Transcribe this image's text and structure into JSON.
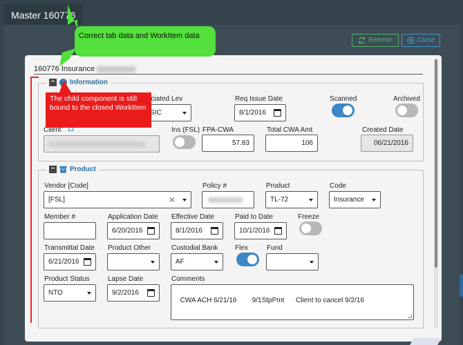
{
  "window": {
    "title": "Master 160776"
  },
  "toolbar": {
    "refresh_label": "Refresh",
    "close_label": "Close"
  },
  "record": {
    "title": "160776 Insurance"
  },
  "annotations": {
    "green": "Correct tab data and WorkItem data",
    "red": "The child component is still bound to the closed WorkItem"
  },
  "information": {
    "section_label": "Information",
    "fields": {
      "assoc_label": "ociated Lev",
      "assoc_value": "SIC",
      "req_issue_label": "Req Issue Date",
      "req_issue_value": "8/1/2016",
      "scanned_label": "Scanned",
      "scanned_on": true,
      "archived_label": "Archived",
      "archived_on": false,
      "client_label": "Client",
      "client_value": "",
      "ins_fsl_label": "Ins (FSL)",
      "ins_fsl_on": false,
      "fpa_cwa_label": "FPA-CWA",
      "fpa_cwa_value": "57.83",
      "total_cwa_label": "Total CWA Amt",
      "total_cwa_value": "106",
      "created_date_label": "Created Date",
      "created_date_value": "06/21/2016"
    }
  },
  "product": {
    "section_label": "Product",
    "fields": {
      "vendor_label": "Vendor [Code]",
      "vendor_value": "[FSL]",
      "policy_label": "Policy #",
      "policy_value": "",
      "product_label": "Product",
      "product_value": "TL-72",
      "code_label": "Code",
      "code_value": "Insurance",
      "member_label": "Member #",
      "member_value": "",
      "application_date_label": "Application Date",
      "application_date_value": "6/20/2016",
      "effective_date_label": "Effective Date",
      "effective_date_value": "8/1/2016",
      "paid_to_date_label": "Paid to Date",
      "paid_to_date_value": "10/1/2016",
      "freeze_label": "Freeze",
      "freeze_on": false,
      "transmittal_date_label": "Transmittal Date",
      "transmittal_date_value": "6/21/2016",
      "product_other_label": "Product Other",
      "product_other_value": "",
      "custodial_bank_label": "Custodial Bank",
      "custodial_bank_value": "AF",
      "flex_label": "Flex",
      "flex_on": true,
      "fund_label": "Fund",
      "fund_value": "",
      "product_status_label": "Product Status",
      "product_status_value": "NTO",
      "lapse_date_label": "Lapse Date",
      "lapse_date_value": "9/2/2016",
      "comments_label": "Comments",
      "comments_value": "CWA ACH 6/21/16        9/1StpPmt      Client to cancel 9/2/16"
    }
  },
  "colors": {
    "backdrop": "#34434c",
    "panel": "#f4f4f4",
    "refresh_green": "#4db36e",
    "close_blue": "#3e9cd6",
    "toggle_on": "#3b87c7",
    "callout_green": "#53df3c",
    "callout_red": "#ea1b1b"
  },
  "icons": {
    "refresh": "refresh-icon",
    "close": "close-circle-icon",
    "info": "info-icon",
    "product": "archive-box-icon",
    "calendar": "calendar-icon",
    "dropdown": "chevron-down-icon"
  }
}
